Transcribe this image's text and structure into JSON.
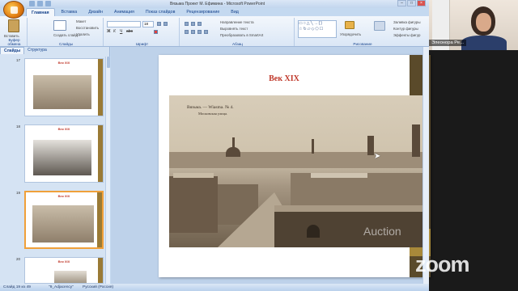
{
  "window": {
    "title": "Вязьма Проект М. Ефимина - Microsoft PowerPoint"
  },
  "tabs": [
    "Главная",
    "Вставка",
    "Дизайн",
    "Анимация",
    "Показ слайдов",
    "Рецензирование",
    "Вид"
  ],
  "ribbon": {
    "paste_label": "Вставить",
    "clipboard_label": "Буфер обмена",
    "new_slide_label": "Создать слайд",
    "layout_label": "Макет",
    "reset_label": "Восстановить",
    "delete_label": "Удалить",
    "slides_group_label": "Слайды",
    "font_group_label": "Шрифт",
    "font_size_value": "18",
    "paragraph_group_label": "Абзац",
    "text_direction_label": "Направление текста",
    "align_text_label": "Выровнять текст",
    "smartart_label": "Преобразовать в SmartArt",
    "arrange_label": "Упорядочить",
    "drawing_group_label": "Рисование",
    "fill_label": "Заливка фигуры",
    "outline_label": "Контур фигуры",
    "effects_label": "Эффекты фигур"
  },
  "panel": {
    "tab_slides": "Слайды",
    "tab_outline": "Структура",
    "thumbnails": [
      {
        "number": "17",
        "title": "Век XIX",
        "selected": false
      },
      {
        "number": "18",
        "title": "Век XIX",
        "selected": false
      },
      {
        "number": "19",
        "title": "Век XIX",
        "selected": true
      },
      {
        "number": "20",
        "title": "Век XIX",
        "selected": false
      }
    ]
  },
  "slide": {
    "title": "Век XIX",
    "photo_caption_1": "Вязьма. — Wiasma. № 4.",
    "photo_caption_2": "Московская улица.",
    "watermark": "Auction"
  },
  "status": {
    "slide_counter": "Слайд 19 из 49",
    "theme": "\"9_Adjacency\"",
    "language": "Русский (Россия)"
  },
  "video": {
    "participant_name": "Элеонора Ре..."
  },
  "zoom_logo": "zoom"
}
